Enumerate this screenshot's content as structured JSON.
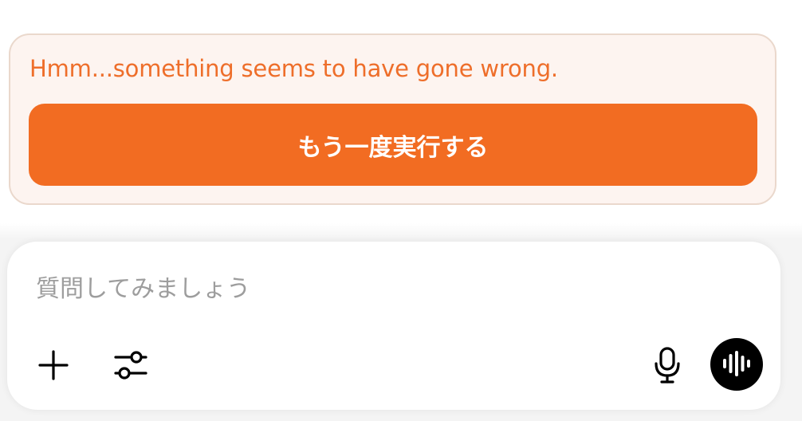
{
  "error": {
    "message": "Hmm...something seems to have gone wrong.",
    "retry_label": "もう一度実行する",
    "accent_color": "#f26c22"
  },
  "composer": {
    "placeholder": "質問してみましょう",
    "icons": {
      "add": "plus-icon",
      "tools": "sliders-icon",
      "mic": "microphone-icon",
      "voice": "voice-waveform-icon"
    }
  }
}
